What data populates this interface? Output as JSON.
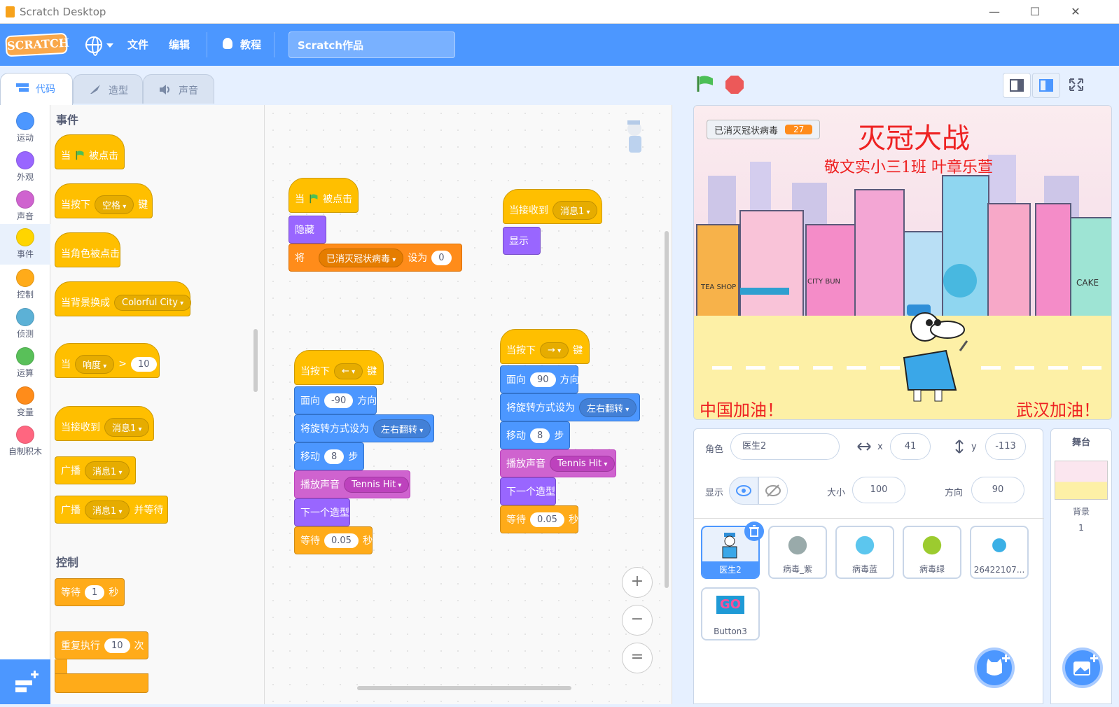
{
  "window": {
    "title": "Scratch Desktop",
    "minimize": "—",
    "maximize": "☐",
    "close": "✕"
  },
  "menubar": {
    "logo": "SCRATCH",
    "file": "文件",
    "edit": "编辑",
    "tutorials": "教程",
    "project_title": "Scratch作品"
  },
  "tabs": {
    "code": "代码",
    "costumes": "造型",
    "sounds": "声音"
  },
  "categories": [
    {
      "label": "运动",
      "color": "#4c97ff"
    },
    {
      "label": "外观",
      "color": "#9966ff"
    },
    {
      "label": "声音",
      "color": "#cf63cf"
    },
    {
      "label": "事件",
      "color": "#ffd500"
    },
    {
      "label": "控制",
      "color": "#ffab19"
    },
    {
      "label": "侦测",
      "color": "#5cb1d6"
    },
    {
      "label": "运算",
      "color": "#59c059"
    },
    {
      "label": "变量",
      "color": "#ff8c1a"
    },
    {
      "label": "自制积木",
      "color": "#ff6680"
    }
  ],
  "palette": {
    "events_title": "事件",
    "when_flag_1": "当",
    "when_flag_2": "被点击",
    "when_key_1": "当按下",
    "when_key_val": "空格",
    "when_key_2": "键",
    "when_sprite_clicked": "当角色被点击",
    "when_backdrop": "当背景换成",
    "when_backdrop_val": "Colorful City",
    "when_loud_1": "当",
    "when_loud_val": "响度",
    "when_loud_gt": ">",
    "when_loud_num": "10",
    "when_receive": "当接收到",
    "when_receive_val": "消息1",
    "broadcast": "广播",
    "broadcast_val": "消息1",
    "broadcast_wait": "广播",
    "broadcast_wait_val": "消息1",
    "broadcast_wait_2": "并等待",
    "control_title": "控制",
    "wait_1": "等待",
    "wait_val": "1",
    "wait_2": "秒",
    "repeat_1": "重复执行",
    "repeat_val": "10",
    "repeat_2": "次"
  },
  "scripts": {
    "s1": {
      "when": "当",
      "clicked": "被点击",
      "hide": "隐藏",
      "set": "将",
      "var": "已消灭冠状病毒",
      "setto": "设为",
      "val": "0"
    },
    "s2": {
      "receive": "当接收到",
      "msg": "消息1",
      "show": "显示"
    },
    "s3": {
      "key_1": "当按下",
      "key": "←",
      "key_2": "键",
      "face": "面向",
      "dir": "-90",
      "dir_l": "方向",
      "rot": "将旋转方式设为",
      "rot_val": "左右翻转",
      "move": "移动",
      "steps": "8",
      "steps_l": "步",
      "play": "播放声音",
      "sound": "Tennis Hit",
      "next": "下一个造型",
      "wait": "等待",
      "wait_val": "0.05",
      "wait_l": "秒"
    },
    "s4": {
      "key_1": "当按下",
      "key": "→",
      "key_2": "键",
      "face": "面向",
      "dir": "90",
      "dir_l": "方向",
      "rot": "将旋转方式设为",
      "rot_val": "左右翻转",
      "move": "移动",
      "steps": "8",
      "steps_l": "步",
      "play": "播放声音",
      "sound": "Tennis Hit",
      "next": "下一个造型",
      "wait": "等待",
      "wait_val": "0.05",
      "wait_l": "秒"
    }
  },
  "zoom": {
    "in": "+",
    "out": "−",
    "reset": "="
  },
  "stage": {
    "monitor_label": "已消灭冠状病毒",
    "monitor_value": "27",
    "title": "灭冠大战",
    "subtitle": "敬文实小三1班 叶章乐萱",
    "bottom_left": "中国加油！",
    "bottom_right": "武汉加油！",
    "shop_tea": "TEA SHOP",
    "shop_bun": "CITY BUN",
    "shop_cake": "CAKE"
  },
  "sprite_info": {
    "sprite_label": "角色",
    "sprite_name": "医生2",
    "x_label": "x",
    "x": "41",
    "y_label": "y",
    "y": "-113",
    "show_label": "显示",
    "size_label": "大小",
    "size": "100",
    "direction_label": "方向",
    "direction": "90"
  },
  "sprites": [
    {
      "name": "医生2",
      "selected": true
    },
    {
      "name": "病毒_紫",
      "selected": false
    },
    {
      "name": "病毒蓝",
      "selected": false
    },
    {
      "name": "病毒绿",
      "selected": false
    },
    {
      "name": "26422107...",
      "selected": false
    },
    {
      "name": "Button3",
      "selected": false,
      "thumb_text": "GO"
    }
  ],
  "stage_panel": {
    "title": "舞台",
    "backdrop_label": "背景",
    "backdrop_count": "1"
  }
}
